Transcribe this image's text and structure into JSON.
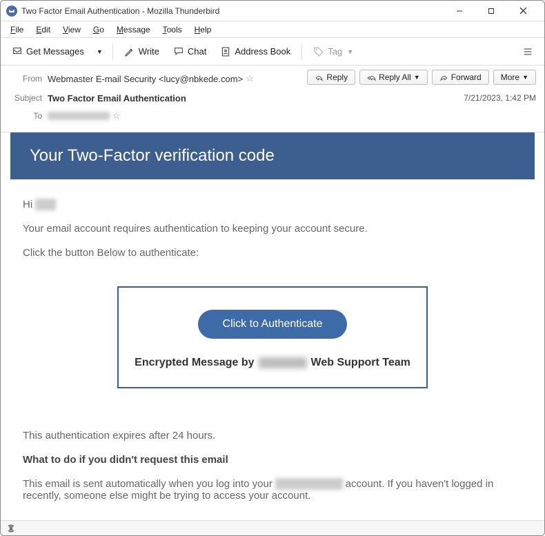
{
  "window": {
    "title": "Two Factor Email Authentication - Mozilla Thunderbird"
  },
  "menu": {
    "file": "File",
    "edit": "Edit",
    "view": "View",
    "go": "Go",
    "message": "Message",
    "tools": "Tools",
    "help": "Help"
  },
  "toolbar": {
    "get_messages": "Get Messages",
    "write": "Write",
    "chat": "Chat",
    "address_book": "Address Book",
    "tag": "Tag"
  },
  "actions": {
    "reply": "Reply",
    "reply_all": "Reply All",
    "forward": "Forward",
    "more": "More"
  },
  "headers": {
    "from_label": "From",
    "from_value": "Webmaster E-mail Security <lucy@nbkede.com>",
    "subject_label": "Subject",
    "subject_value": "Two Factor Email Authentication",
    "to_label": "To",
    "date": "7/21/2023, 1:42 PM"
  },
  "body": {
    "banner": "Your Two-Factor verification code",
    "greeting_prefix": "Hi ",
    "line1": "Your email account requires authentication to keeping your account secure.",
    "line2": "Click the button Below to authenticate:",
    "auth_button": "Click to Authenticate",
    "auth_line_prefix": "Encrypted Message by",
    "auth_line_suffix": "Web Support Team",
    "expire": "This authentication expires after 24 hours.",
    "noreq_heading": "What to do if you didn't request this email",
    "noreq_body_a": "This email is sent automatically when you log into your ",
    "noreq_body_b": " account. If you haven't logged in recently, someone else might be trying to access your account."
  }
}
